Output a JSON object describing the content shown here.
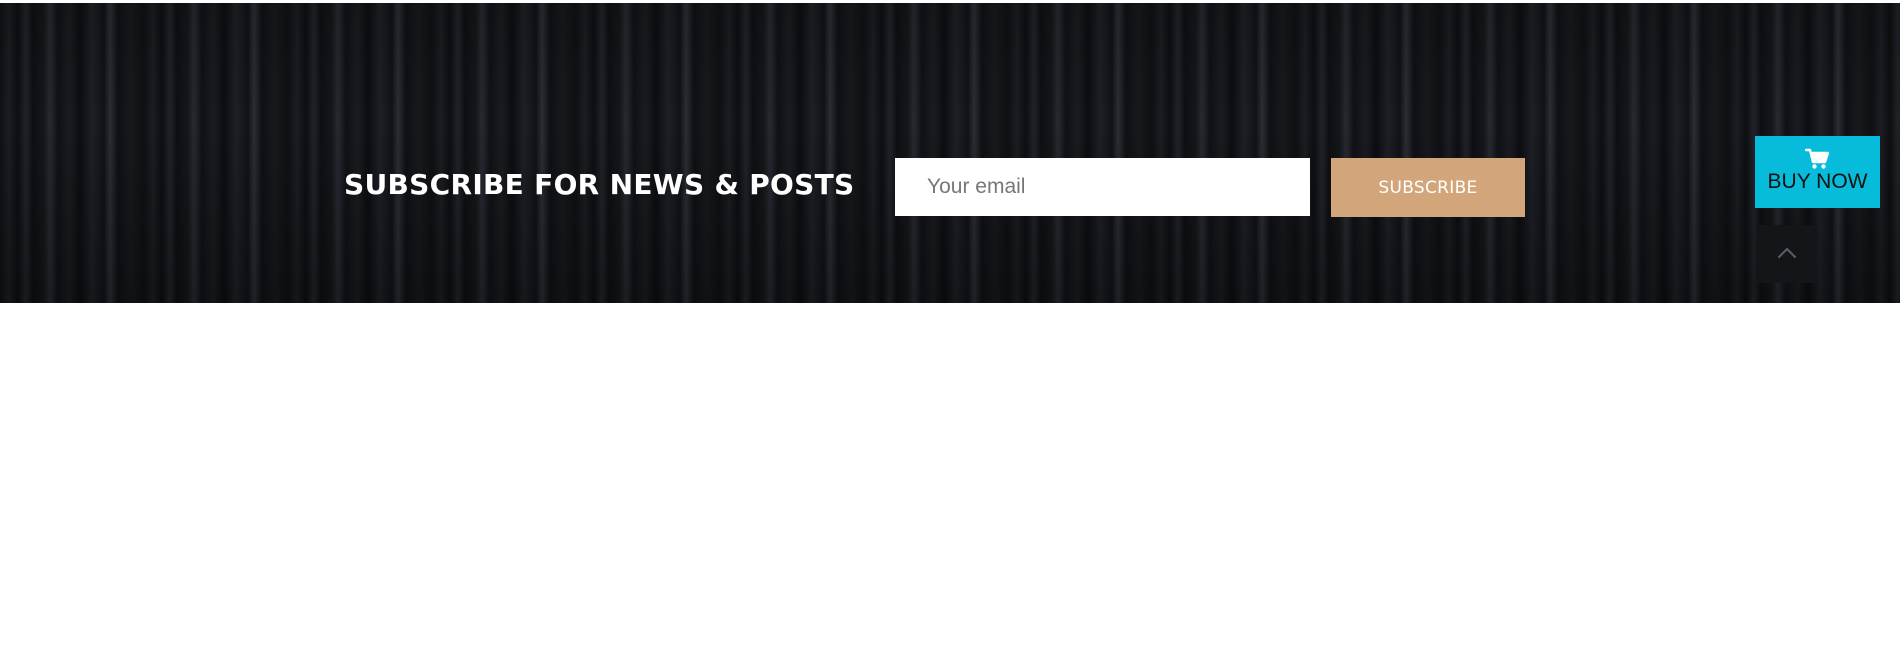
{
  "subscribe": {
    "title": "SUBSCRIBE FOR NEWS & POSTS",
    "email_placeholder": "Your email",
    "email_value": "",
    "button_label": "SUBSCRIBE"
  },
  "buy_now": {
    "label": "BUY NOW",
    "icon": "cart-icon"
  },
  "scroll_top": {
    "icon": "chevron-up-icon"
  },
  "colors": {
    "band_background": "#131418",
    "subscribe_button": "#d2a67a",
    "buy_now_button": "#06bcda",
    "page_background": "#ffffff"
  }
}
